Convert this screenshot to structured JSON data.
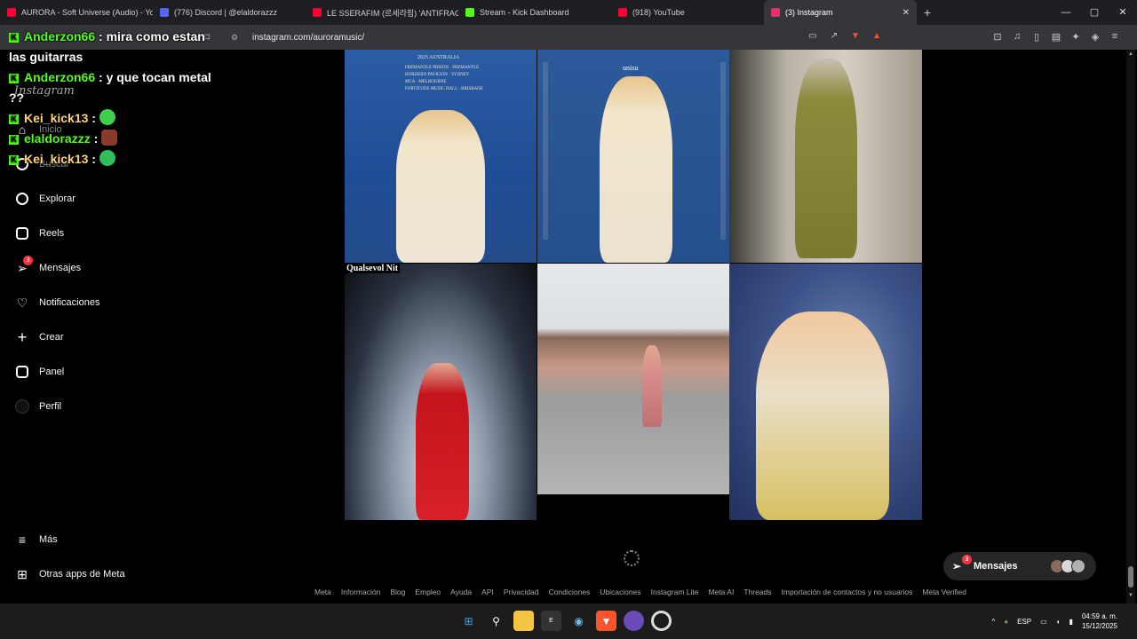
{
  "browser": {
    "tabs": [
      {
        "title": "AURORA - Soft Universe (Audio) - Yo",
        "color": "#ff0033",
        "active": false
      },
      {
        "title": "(776) Discord | @elaldorazzz",
        "color": "#5865f2",
        "active": false
      },
      {
        "title": "LE SSERAFIM (르세라핌) 'ANTIFRAGI",
        "color": "#ff0033",
        "active": false
      },
      {
        "title": "Stream - Kick Dashboard",
        "color": "#53fc18",
        "active": false
      },
      {
        "title": "(918) YouTube",
        "color": "#ff0033",
        "active": false
      },
      {
        "title": "(3) Instagram",
        "color": "#e1306c",
        "active": true
      }
    ],
    "new_tab": "+",
    "url": "instagram.com/auroramusic/",
    "window_controls": {
      "minimize": "—",
      "maximize": "▢",
      "close": "✕"
    }
  },
  "chat": {
    "messages": [
      {
        "user": "Anderzon66",
        "text": ": mira como estan las guitarras"
      },
      {
        "user": "Anderzon66",
        "text": ": y que tocan metal ??"
      },
      {
        "user": "Kei_kick13",
        "text": ":"
      },
      {
        "user": "elaldorazzz",
        "text": ":"
      },
      {
        "user": "Kei_kick13",
        "text": ":"
      }
    ]
  },
  "sidebar": {
    "logo_text": "Instagram",
    "items": [
      {
        "label": "Inicio",
        "icon": "home-icon"
      },
      {
        "label": "Buscar",
        "icon": "search-icon"
      },
      {
        "label": "Explorar",
        "icon": "compass-icon"
      },
      {
        "label": "Reels",
        "icon": "reels-icon"
      },
      {
        "label": "Mensajes",
        "icon": "messenger-icon",
        "badge": "3"
      },
      {
        "label": "Notificaciones",
        "icon": "heart-icon"
      },
      {
        "label": "Crear",
        "icon": "plus-icon"
      },
      {
        "label": "Panel",
        "icon": "dashboard-icon"
      },
      {
        "label": "Perfil",
        "icon": "avatar-icon"
      }
    ],
    "more": "Más",
    "meta_apps": "Otras apps de Meta"
  },
  "posts": {
    "poster1": {
      "headline": "2025 AUSTRALIA",
      "lines": [
        "FREMANTLE PRISON · FREMANTLE",
        "HORDERN PAVILION · SYDNEY",
        "MCA · MELBOURNE",
        "FORTITUDE MUSIC HALL · BRISBANE"
      ]
    },
    "poster2": {
      "brand": "unisu"
    },
    "caption4": "Qualsevol Nit"
  },
  "footer_links": [
    "Meta",
    "Información",
    "Blog",
    "Empleo",
    "Ayuda",
    "API",
    "Privacidad",
    "Condiciones",
    "Ubicaciones",
    "Instagram Lite",
    "Meta AI",
    "Threads",
    "Importación de contactos y no usuarios",
    "Meta Verified"
  ],
  "messages_pill": {
    "label": "Mensajes",
    "badge": "3"
  },
  "taskbar": {
    "language": "ESP",
    "time": "04:59 a. m.",
    "date": "15/12/2025"
  }
}
